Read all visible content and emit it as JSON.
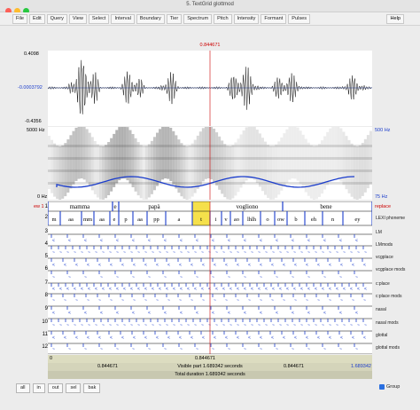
{
  "window": {
    "title": "5. TextGrid glottmod"
  },
  "menu": {
    "items": [
      "File",
      "Edit",
      "Query",
      "View",
      "Select",
      "Interval",
      "Boundary",
      "Tier",
      "Spectrum",
      "Pitch",
      "Intensity",
      "Formant",
      "Pulses"
    ],
    "help": "Help"
  },
  "cursor_time": "0.844671",
  "waveform": {
    "max": "0.4098",
    "mid": "-0.0003792",
    "min": "-0.4356"
  },
  "spectrogram": {
    "top_freq": "5000 Hz",
    "bottom_freq": "0 Hz",
    "pitch_top": "500 Hz",
    "pitch_bottom": "75 Hz"
  },
  "left_markers": {
    "ew": "ew 1",
    "tier_nums": [
      "1",
      "2",
      "3",
      "4",
      "5",
      "6",
      "7",
      "8",
      "9",
      "10",
      "11",
      "12"
    ]
  },
  "right_markers": {
    "replace": "replace"
  },
  "tiers": {
    "names": [
      "LEXI phoneme",
      "LM",
      "LMmods",
      "vcgplace",
      "vcgplace mods",
      "c:place",
      "c:place mods",
      "nasal",
      "nasal mods",
      "glottal",
      "glottal mods",
      ""
    ],
    "words": [
      "mamma",
      "e",
      "papà",
      "vogliono",
      "bene"
    ],
    "phonemes": [
      "m",
      "aa",
      "mm",
      "aa",
      "e",
      "p",
      "aa",
      "pp",
      "a",
      "t",
      "i",
      "v",
      "ao",
      "lhlh",
      "o",
      "ow",
      "b",
      "eh",
      "n",
      "ey"
    ]
  },
  "bottom": {
    "left_time": "0",
    "cursor_time": "0.844671",
    "right_time": "1.689342",
    "visible": "Visible part 1.689342 seconds",
    "total": "Total duration 1.689342 seconds"
  },
  "buttons": [
    "all",
    "in",
    "out",
    "sel",
    "bak"
  ],
  "group_label": "Group"
}
